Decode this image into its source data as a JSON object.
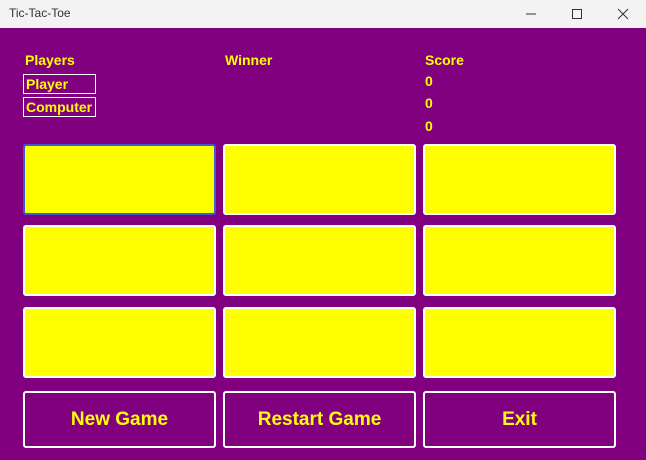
{
  "window": {
    "title": "Tic-Tac-Toe"
  },
  "headers": {
    "players": "Players",
    "winner": "Winner",
    "score": "Score"
  },
  "players": [
    "Player",
    "Computer"
  ],
  "scores": [
    "0",
    "0",
    "0"
  ],
  "board": [
    "",
    "",
    "",
    "",
    "",
    "",
    "",
    "",
    ""
  ],
  "buttons": {
    "new_game": "New Game",
    "restart_game": "Restart Game",
    "exit": "Exit"
  },
  "colors": {
    "background": "#800080",
    "text": "#ffff00",
    "cell": "#ffff00",
    "border": "#ffffff",
    "focus": "#3a5bd9"
  },
  "icons": {
    "minimize": "minimize-icon",
    "maximize": "maximize-icon",
    "close": "close-icon"
  }
}
